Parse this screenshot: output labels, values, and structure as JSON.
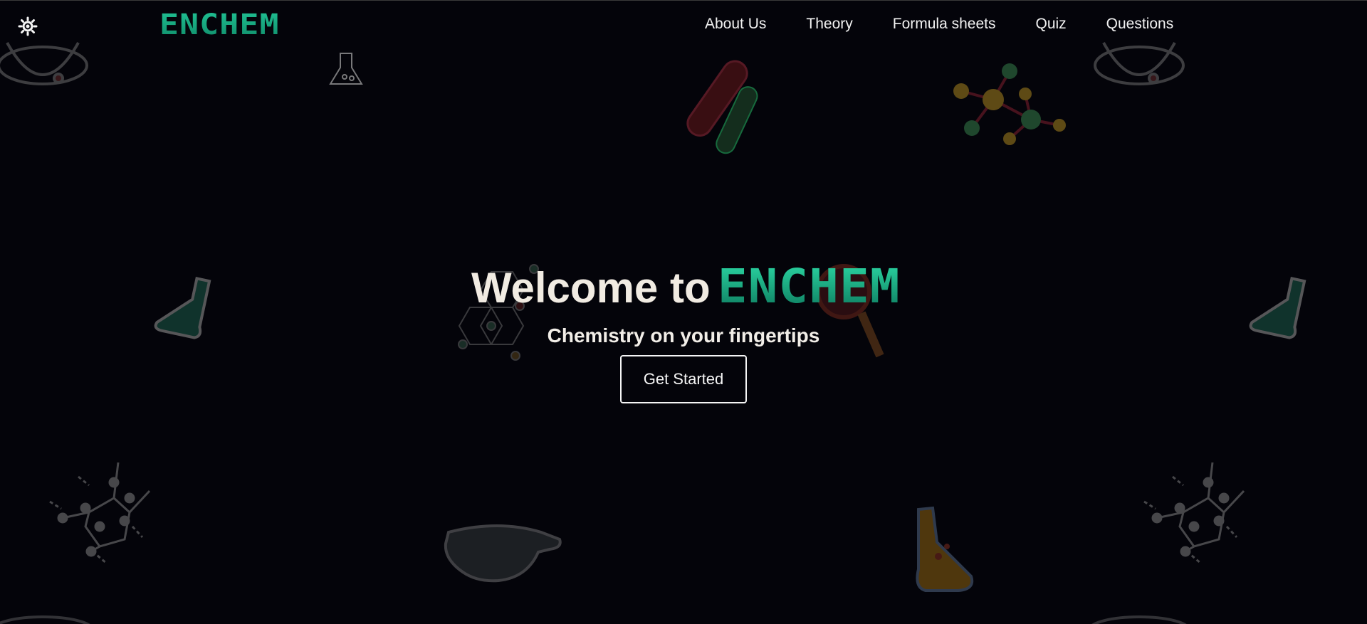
{
  "header": {
    "theme_toggle_icon": "sun-icon",
    "logo_text": "ENCHEM",
    "nav_items": [
      {
        "label": "About Us"
      },
      {
        "label": "Theory"
      },
      {
        "label": "Formula sheets"
      },
      {
        "label": "Quiz"
      },
      {
        "label": "Questions"
      }
    ]
  },
  "hero": {
    "title_prefix": "Welcome to",
    "title_brand": "ENCHEM",
    "subtitle": "Chemistry on your fingertips",
    "cta_label": "Get Started"
  },
  "background_icons": [
    "atom-icon",
    "beaker-icon",
    "test-tubes-icon",
    "molecule-icon",
    "flask-icon",
    "hexagon-molecule-icon",
    "magnifier-icon",
    "benzene-molecule-icon",
    "goggles-icon",
    "conical-flask-icon"
  ],
  "colors": {
    "background": "#04040a",
    "brand_green": "#18a57f",
    "text_light": "#f1ebe2"
  }
}
